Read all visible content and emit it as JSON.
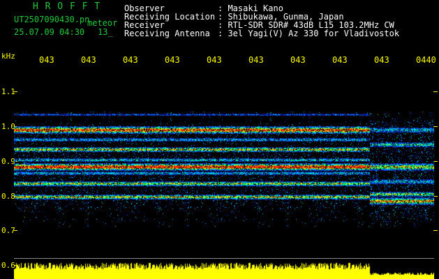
{
  "header": {
    "app_name": "H R O F F T",
    "file_name": "UT2507090430.pn",
    "meteor_label": "meteor",
    "timestamp": "25.07.09 04:30",
    "count": "13_"
  },
  "station": [
    {
      "label": "Observer",
      "value": ": Masaki Kano"
    },
    {
      "label": "Receiving Location",
      "value": ": Shibukawa, Gunma, Japan"
    },
    {
      "label": "Receiver",
      "value": ": RTL-SDR SDR# 43dB L15 103.2MHz CW"
    },
    {
      "label": "Receiving Antenna",
      "value": ": 3el Yagi(V) Az 330 for Vladivostok"
    }
  ],
  "axes": {
    "y_unit": "kHz",
    "y_ticks": [
      "1.1",
      "1.0",
      "0.9",
      "0.8",
      "0.7",
      "0.6"
    ],
    "x_ticks": [
      "043",
      "043",
      "043",
      "043",
      "043",
      "043",
      "043",
      "043",
      "043",
      "0440"
    ]
  },
  "colors": {
    "title": "#22c93a",
    "info_text": "#ffffff",
    "axis": "#ffff00",
    "background": "#000000"
  }
}
